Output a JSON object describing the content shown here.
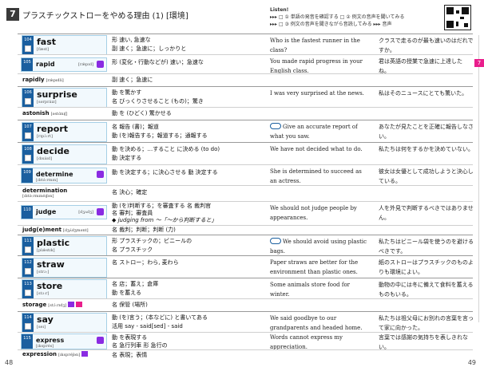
{
  "header": {
    "chapter_number": "7",
    "chapter_title": "プラスチックストローをやめる理由 (1) [環境]",
    "listen_label": "Listen!",
    "listen_line1": "▸▸▸ □ ① 単語の発音を確認する  □ ② 例文の音声を聞いてみる",
    "listen_line2": "▸▸▸ □ ③ 例文の音声を聞きながら音読してみる   ▸▸▸ 音声"
  },
  "side_tab": "7",
  "entries": [
    {
      "num": "104",
      "word": "fast",
      "pron": "[fæst]",
      "meanings": [
        "形 速い, 急速な",
        "副 速く；急速に；しっかりと"
      ],
      "en": "Who is the fastest runner in the class?",
      "ja": "クラスで走るのが最も速いのはだれですか。"
    },
    {
      "num": "105",
      "word": "rapid",
      "pron": "[rǽpɪd]",
      "small": true,
      "meanings": [
        "形 (変化・行動などが) 速い；急速な"
      ],
      "en": "You made rapid progress in your English class.",
      "ja": "君は英語の授業で急速に上達した ね。"
    },
    {
      "deriv": "rapidly",
      "pron": "[rǽpɪdli]",
      "meanings": [
        "副 速く；急速に"
      ]
    },
    {
      "num": "106",
      "word": "surprise",
      "pron": "[sərpráɪz]",
      "meanings": [
        "動 を驚かす",
        "名 びっくりさせること (もの)；驚き"
      ],
      "en": "I was very surprised at the news.",
      "ja": "私はそのニュースにとても驚いた。"
    },
    {
      "deriv": "astonish",
      "pron": "[əstɑ́nɪʃ]",
      "meanings": [
        "動 を (ひどく) 驚かせる"
      ]
    },
    {
      "num": "107",
      "word": "report",
      "pron": "[rɪpɔ́ːrt]",
      "meanings": [
        "名 報告 (書)；報道",
        "動 (を)報告する；報道する；通報する"
      ],
      "en": "Give an accurate report of what you saw.",
      "ja": "あなたが見たことを正確に報告しなさい。"
    },
    {
      "num": "108",
      "word": "decide",
      "pron": "[dɪsáɪd]",
      "meanings": [
        "動 を決める；…すること に決める (to do)",
        "動 決定する"
      ],
      "en": "We have not decided what to do.",
      "ja": "私たちは何をするかを決めていない。"
    },
    {
      "num": "109",
      "word": "determine",
      "pron": "[dɪtə́ːrmɪn]",
      "small": true,
      "meanings": [
        "動 を決定する；に決心させる  動 決定する"
      ],
      "en": "She is determined to succeed as an actress.",
      "ja": "彼女は女優として成功しようと決心している。"
    },
    {
      "deriv": "determination",
      "pron": "[dɪtə̀ːrmɪnéɪʃən]",
      "meanings": [
        "名 決心；確定"
      ]
    },
    {
      "num": "110",
      "word": "judge",
      "pron": "[dʒʌdʒ]",
      "small": true,
      "meanings": [
        "動 (を)判断する；を審査する  名 裁判官",
        "名 審判；審査員",
        "◆ judging from ～「～から判断すると」"
      ],
      "en": "We should not judge people by appearances.",
      "ja": "人を外見で判断するべきではありません。"
    },
    {
      "deriv": "judg(e)ment",
      "pron": "[dʒʌ́dʒmənt]",
      "meanings": [
        "名 裁判；判断；判断 (力)"
      ]
    },
    {
      "num": "111",
      "word": "plastic",
      "pron": "[plǽstɪk]",
      "meanings": [
        "形 プラスチックの；ビニールの",
        "名 プラスチック"
      ],
      "en": "We should avoid using plastic bags.",
      "ja": "私たちはビニール袋を使うのを避けるべきです。"
    },
    {
      "num": "112",
      "word": "straw",
      "pron": "[strɔː]",
      "meanings": [
        "名 ストロー；わら, 麦わら"
      ],
      "en": "Paper straws are better for the environment than plastic ones.",
      "ja": "紙のストローはプラスチックのものよりも環境によい。"
    },
    {
      "num": "113",
      "word": "store",
      "pron": "[stɔːr]",
      "meanings": [
        "名 店；蓄え；倉庫",
        "動 を蓄える"
      ],
      "en": "Some animals store food for winter.",
      "ja": "動物の中には冬に備えて食料を蓄えるものもいる。"
    },
    {
      "deriv": "storage",
      "pron": "[stɔ́ːrɪdʒ]",
      "meanings": [
        "名 保管 (場所)"
      ]
    },
    {
      "num": "114",
      "word": "say",
      "pron": "[seɪ]",
      "meanings": [
        "動 (を)言う；(本などに) と書いてある",
        "活用 say - said[sed] - said"
      ],
      "en": "We said goodbye to our grandparents and headed home.",
      "ja": "私たちは祖父母にお別れの言葉を言って家に向かった。"
    },
    {
      "num": "115",
      "word": "express",
      "pron": "[ɪksprés]",
      "small": true,
      "meanings": [
        "動 を表現する",
        "名 急行列車   形 急行の"
      ],
      "en": "Words cannot express my appreciation.",
      "ja": "言葉では感謝の気持ちを表しきれない。"
    },
    {
      "deriv": "expression",
      "pron": "[ɪkspréʃən]",
      "meanings": [
        "名 表現；表情"
      ]
    }
  ],
  "page_left": "48",
  "page_right": "49"
}
